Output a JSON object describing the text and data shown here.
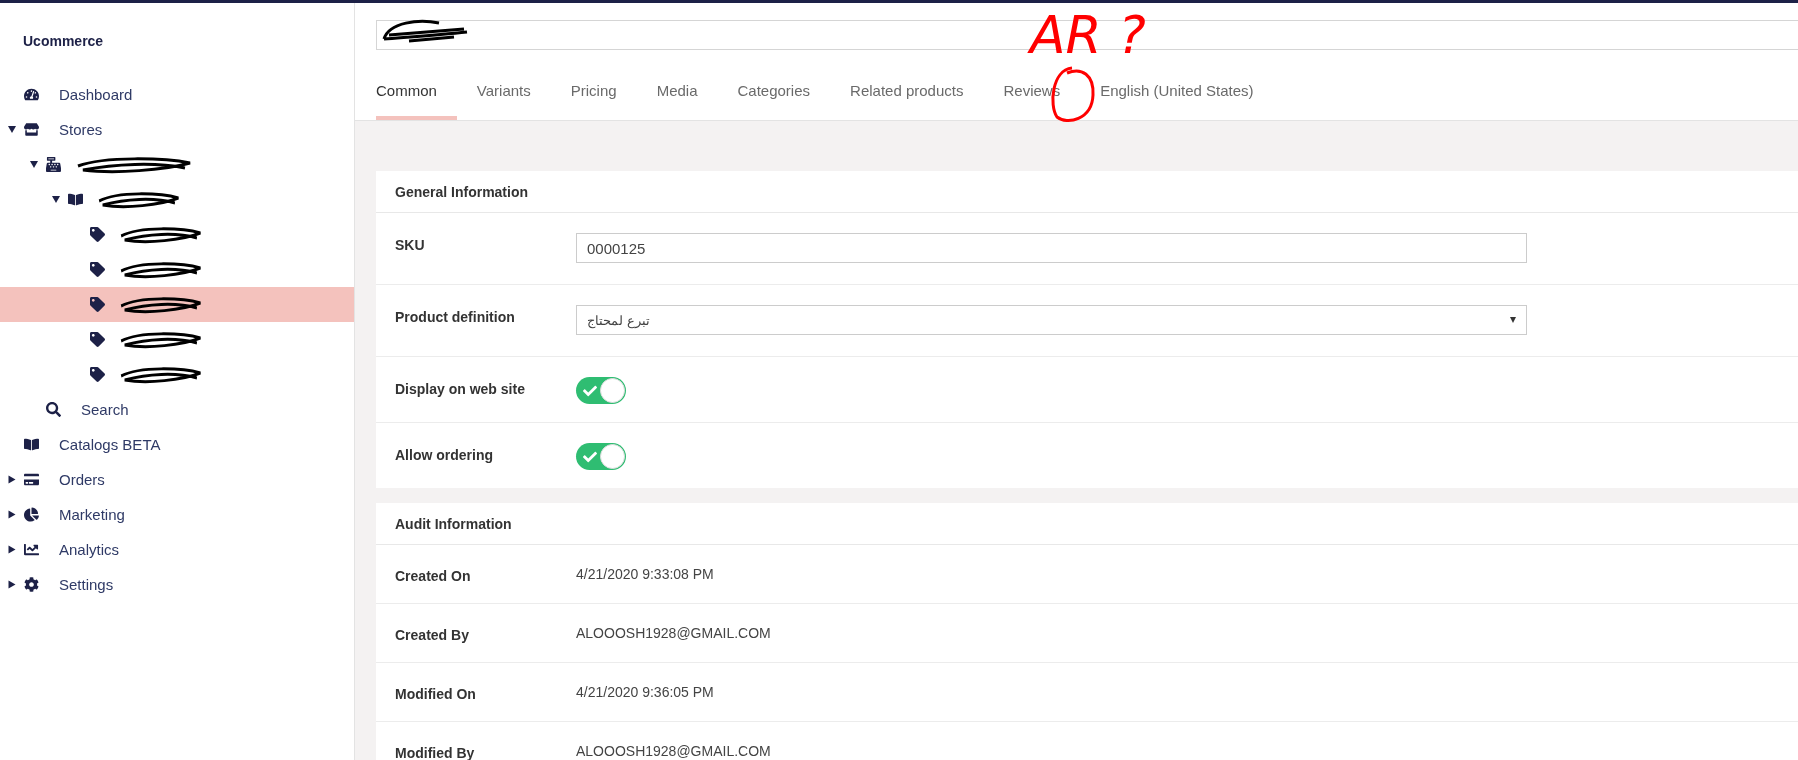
{
  "sidebar": {
    "brand": "Ucommerce",
    "items": [
      {
        "kind": "link",
        "label": "Dashboard"
      },
      {
        "kind": "group",
        "label": "Stores",
        "expanded": true,
        "children": [
          {
            "kind": "group",
            "expanded": true,
            "children": [
              {
                "kind": "group",
                "expanded": true,
                "children": [
                  {
                    "kind": "product",
                    "selected": false
                  },
                  {
                    "kind": "product",
                    "selected": false
                  },
                  {
                    "kind": "product",
                    "selected": true
                  },
                  {
                    "kind": "product",
                    "selected": false
                  },
                  {
                    "kind": "product",
                    "selected": false
                  }
                ]
              }
            ]
          },
          {
            "kind": "link",
            "label": "Search"
          }
        ]
      },
      {
        "kind": "link",
        "label": "Catalogs BETA"
      },
      {
        "kind": "group",
        "label": "Orders",
        "expanded": false
      },
      {
        "kind": "group",
        "label": "Marketing",
        "expanded": false
      },
      {
        "kind": "group",
        "label": "Analytics",
        "expanded": false
      },
      {
        "kind": "group",
        "label": "Settings",
        "expanded": false
      }
    ]
  },
  "annotation": {
    "text": "AR ?"
  },
  "tabs": [
    {
      "label": "Common",
      "selected": true
    },
    {
      "label": "Variants",
      "selected": false
    },
    {
      "label": "Pricing",
      "selected": false
    },
    {
      "label": "Media",
      "selected": false
    },
    {
      "label": "Categories",
      "selected": false
    },
    {
      "label": "Related products",
      "selected": false
    },
    {
      "label": "Reviews",
      "selected": false
    },
    {
      "label": "English (United States)",
      "selected": false
    }
  ],
  "general": {
    "title": "General Information",
    "fields": [
      {
        "kind": "text",
        "label": "SKU",
        "value": "0000125"
      },
      {
        "kind": "select",
        "label": "Product definition",
        "value": "تبرع لمحتاج"
      },
      {
        "kind": "toggle",
        "label": "Display on web site",
        "on": true
      },
      {
        "kind": "toggle",
        "label": "Allow ordering",
        "on": true
      }
    ]
  },
  "audit": {
    "title": "Audit Information",
    "rows": [
      {
        "label": "Created On",
        "value": "4/21/2020 9:33:08 PM"
      },
      {
        "label": "Created By",
        "value": "ALOOOSH1928@GMAIL.COM"
      },
      {
        "label": "Modified On",
        "value": "4/21/2020 9:36:05 PM"
      },
      {
        "label": "Modified By",
        "value": "ALOOOSH1928@GMAIL.COM"
      }
    ]
  }
}
